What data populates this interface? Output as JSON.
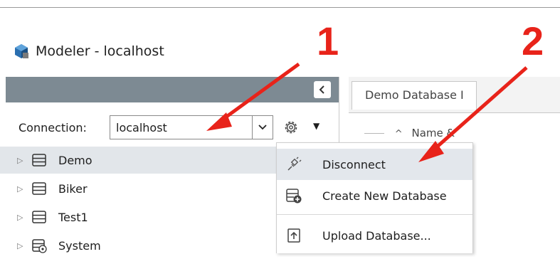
{
  "window": {
    "title": "Modeler - localhost"
  },
  "connection": {
    "label": "Connection:",
    "value": "localhost"
  },
  "tree": {
    "items": [
      {
        "label": "Demo",
        "icon": "database-icon",
        "selected": true
      },
      {
        "label": "Biker",
        "icon": "database-icon",
        "selected": false
      },
      {
        "label": "Test1",
        "icon": "database-icon",
        "selected": false
      },
      {
        "label": "System",
        "icon": "system-database-icon",
        "selected": false
      }
    ]
  },
  "tabs": [
    {
      "label": "Demo Database I"
    }
  ],
  "grid": {
    "column_header": "Name &"
  },
  "context_menu": {
    "items": [
      {
        "label": "Disconnect",
        "icon": "plug-icon",
        "highlighted": true
      },
      {
        "label": "Create New Database",
        "icon": "database-add-icon",
        "highlighted": false
      },
      {
        "label": "Upload Database...",
        "icon": "upload-icon",
        "highlighted": false
      }
    ]
  },
  "annotations": {
    "callout_1": "1",
    "callout_2": "2",
    "color": "#e8231a"
  },
  "colors": {
    "header_bar": "#7d8a93",
    "selection": "#e2e6ea",
    "menu_highlight": "#e3e7ec"
  }
}
